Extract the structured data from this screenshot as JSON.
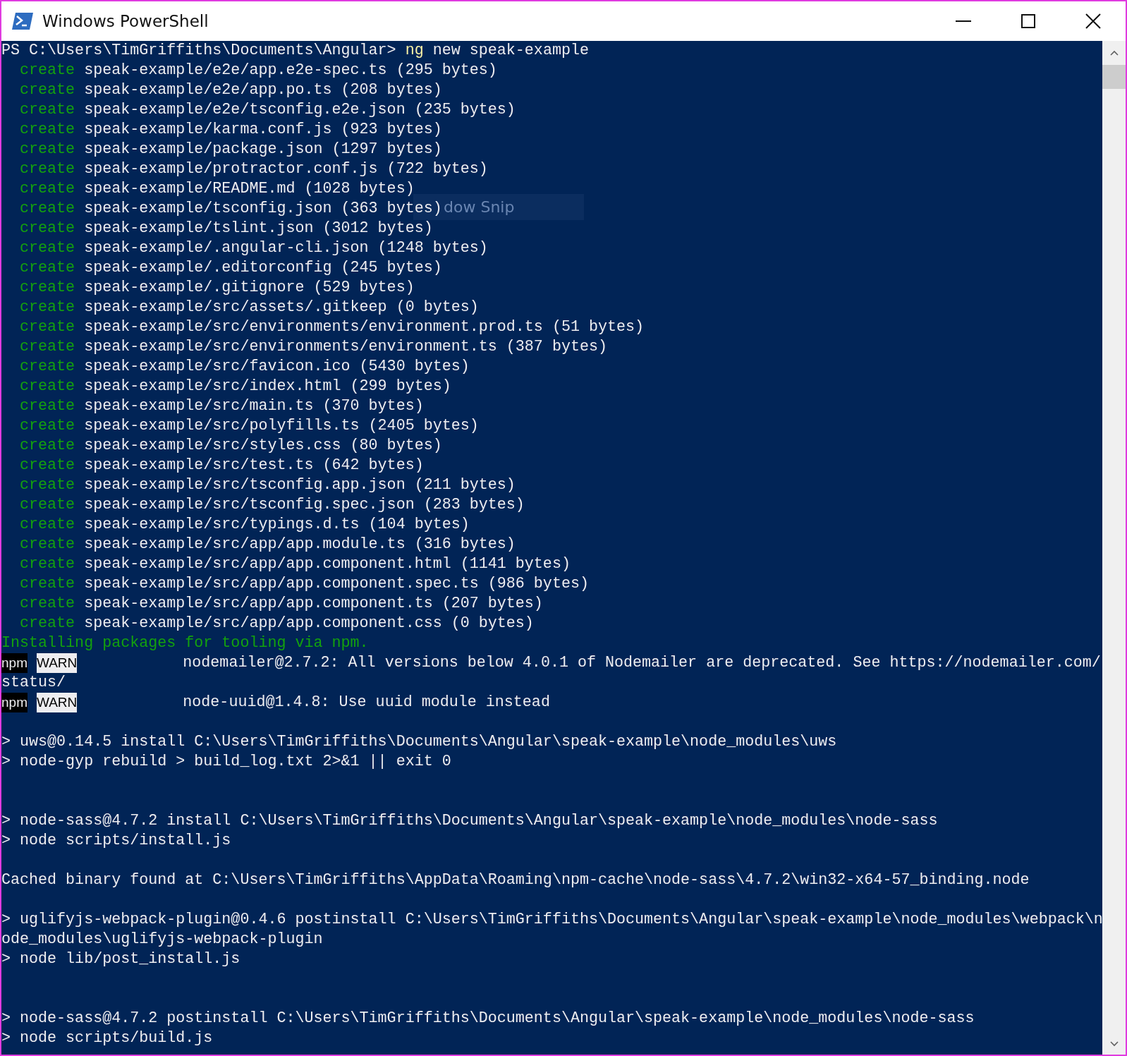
{
  "window": {
    "title": "Windows PowerShell"
  },
  "console": {
    "lines": [
      {
        "kind": "prompt",
        "prompt": "PS C:\\Users\\TimGriffiths\\Documents\\Angular> ",
        "command": "ng",
        "args": " new speak-example"
      },
      {
        "kind": "create",
        "action": "create",
        "text": "speak-example/e2e/app.e2e-spec.ts (295 bytes)"
      },
      {
        "kind": "create",
        "action": "create",
        "text": "speak-example/e2e/app.po.ts (208 bytes)"
      },
      {
        "kind": "create",
        "action": "create",
        "text": "speak-example/e2e/tsconfig.e2e.json (235 bytes)"
      },
      {
        "kind": "create",
        "action": "create",
        "text": "speak-example/karma.conf.js (923 bytes)"
      },
      {
        "kind": "create",
        "action": "create",
        "text": "speak-example/package.json (1297 bytes)"
      },
      {
        "kind": "create",
        "action": "create",
        "text": "speak-example/protractor.conf.js (722 bytes)"
      },
      {
        "kind": "create",
        "action": "create",
        "text": "speak-example/README.md (1028 bytes)"
      },
      {
        "kind": "create",
        "action": "create",
        "text": "speak-example/tsconfig.json (363 bytes)"
      },
      {
        "kind": "create",
        "action": "create",
        "text": "speak-example/tslint.json (3012 bytes)"
      },
      {
        "kind": "create",
        "action": "create",
        "text": "speak-example/.angular-cli.json (1248 bytes)"
      },
      {
        "kind": "create",
        "action": "create",
        "text": "speak-example/.editorconfig (245 bytes)"
      },
      {
        "kind": "create",
        "action": "create",
        "text": "speak-example/.gitignore (529 bytes)"
      },
      {
        "kind": "create",
        "action": "create",
        "text": "speak-example/src/assets/.gitkeep (0 bytes)"
      },
      {
        "kind": "create",
        "action": "create",
        "text": "speak-example/src/environments/environment.prod.ts (51 bytes)"
      },
      {
        "kind": "create",
        "action": "create",
        "text": "speak-example/src/environments/environment.ts (387 bytes)"
      },
      {
        "kind": "create",
        "action": "create",
        "text": "speak-example/src/favicon.ico (5430 bytes)"
      },
      {
        "kind": "create",
        "action": "create",
        "text": "speak-example/src/index.html (299 bytes)"
      },
      {
        "kind": "create",
        "action": "create",
        "text": "speak-example/src/main.ts (370 bytes)"
      },
      {
        "kind": "create",
        "action": "create",
        "text": "speak-example/src/polyfills.ts (2405 bytes)"
      },
      {
        "kind": "create",
        "action": "create",
        "text": "speak-example/src/styles.css (80 bytes)"
      },
      {
        "kind": "create",
        "action": "create",
        "text": "speak-example/src/test.ts (642 bytes)"
      },
      {
        "kind": "create",
        "action": "create",
        "text": "speak-example/src/tsconfig.app.json (211 bytes)"
      },
      {
        "kind": "create",
        "action": "create",
        "text": "speak-example/src/tsconfig.spec.json (283 bytes)"
      },
      {
        "kind": "create",
        "action": "create",
        "text": "speak-example/src/typings.d.ts (104 bytes)"
      },
      {
        "kind": "create",
        "action": "create",
        "text": "speak-example/src/app/app.module.ts (316 bytes)"
      },
      {
        "kind": "create",
        "action": "create",
        "text": "speak-example/src/app/app.component.html (1141 bytes)"
      },
      {
        "kind": "create",
        "action": "create",
        "text": "speak-example/src/app/app.component.spec.ts (986 bytes)"
      },
      {
        "kind": "create",
        "action": "create",
        "text": "speak-example/src/app/app.component.ts (207 bytes)"
      },
      {
        "kind": "create",
        "action": "create",
        "text": "speak-example/src/app/app.component.css (0 bytes)"
      },
      {
        "kind": "info",
        "text": "Installing packages for tooling via npm."
      },
      {
        "kind": "warn",
        "source": "npm",
        "level": "WARN",
        "text": "nodemailer@2.7.2: All versions below 4.0.1 of Nodemailer are deprecated. See https://nodemailer.com/"
      },
      {
        "kind": "output",
        "text": "status/"
      },
      {
        "kind": "warn",
        "source": "npm",
        "level": "WARN",
        "text": "node-uuid@1.4.8: Use uuid module instead"
      },
      {
        "kind": "blank"
      },
      {
        "kind": "output",
        "text": "> uws@0.14.5 install C:\\Users\\TimGriffiths\\Documents\\Angular\\speak-example\\node_modules\\uws"
      },
      {
        "kind": "output",
        "text": "> node-gyp rebuild > build_log.txt 2>&1 || exit 0"
      },
      {
        "kind": "blank"
      },
      {
        "kind": "blank"
      },
      {
        "kind": "output",
        "text": "> node-sass@4.7.2 install C:\\Users\\TimGriffiths\\Documents\\Angular\\speak-example\\node_modules\\node-sass"
      },
      {
        "kind": "output",
        "text": "> node scripts/install.js"
      },
      {
        "kind": "blank"
      },
      {
        "kind": "output",
        "text": "Cached binary found at C:\\Users\\TimGriffiths\\AppData\\Roaming\\npm-cache\\node-sass\\4.7.2\\win32-x64-57_binding.node"
      },
      {
        "kind": "blank"
      },
      {
        "kind": "output",
        "text": "> uglifyjs-webpack-plugin@0.4.6 postinstall C:\\Users\\TimGriffiths\\Documents\\Angular\\speak-example\\node_modules\\webpack\\n"
      },
      {
        "kind": "output",
        "text": "ode_modules\\uglifyjs-webpack-plugin"
      },
      {
        "kind": "output",
        "text": "> node lib/post_install.js"
      },
      {
        "kind": "blank"
      },
      {
        "kind": "blank"
      },
      {
        "kind": "output",
        "text": "> node-sass@4.7.2 postinstall C:\\Users\\TimGriffiths\\Documents\\Angular\\speak-example\\node_modules\\node-sass"
      },
      {
        "kind": "output",
        "text": "> node scripts/build.js"
      }
    ]
  },
  "snip_tooltip": {
    "text": "dow Snip"
  }
}
